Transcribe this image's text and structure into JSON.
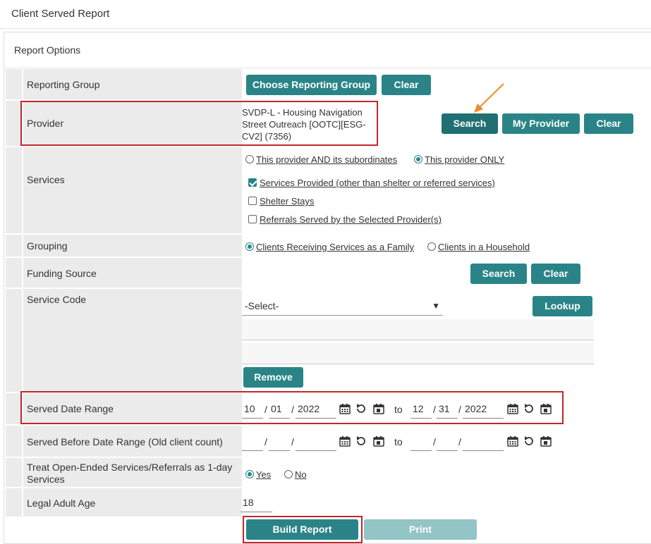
{
  "window_title": "Client Served Report",
  "panel_title": "Report Options",
  "reporting_group": {
    "label": "Reporting Group",
    "choose_button": "Choose Reporting Group",
    "clear_button": "Clear"
  },
  "provider": {
    "label": "Provider",
    "name_line1": "SVDP-L - Housing Navigation",
    "name_line2": "Street Outreach [OOTC][ESG-",
    "name_line3": "CV2] (7356)",
    "search_button": "Search",
    "my_provider_button": "My Provider",
    "clear_button": "Clear",
    "scope_options": [
      {
        "label": "This provider AND its subordinates",
        "selected": false
      },
      {
        "label": "This provider ONLY",
        "selected": true
      }
    ]
  },
  "services": {
    "label": "Services",
    "options": [
      {
        "label": "Services Provided (other than shelter or referred services)",
        "checked": true
      },
      {
        "label": "Shelter Stays",
        "checked": false
      },
      {
        "label": "Referrals Served by the Selected Provider(s)",
        "checked": false
      }
    ]
  },
  "grouping": {
    "label": "Grouping",
    "options": [
      {
        "label": "Clients Receiving Services as a Family",
        "selected": true
      },
      {
        "label": "Clients in a Household",
        "selected": false
      }
    ]
  },
  "funding_source": {
    "label": "Funding Source",
    "search_button": "Search",
    "clear_button": "Clear"
  },
  "service_code": {
    "label": "Service Code",
    "select_value": "-Select-",
    "lookup_button": "Lookup",
    "remove_button": "Remove"
  },
  "served_date_range": {
    "label": "Served Date Range",
    "from": {
      "month": "10",
      "day": "01",
      "year": "2022"
    },
    "to_label": "to",
    "to": {
      "month": "12",
      "day": "31",
      "year": "2022"
    }
  },
  "served_before": {
    "label": "Served Before Date Range (Old client count)",
    "to_label": "to",
    "slash": "/"
  },
  "treat_open_ended": {
    "label_line1": "Treat Open-Ended Services/Referrals as 1-day",
    "label_line2": "Services",
    "options": [
      {
        "label": "Yes",
        "selected": true
      },
      {
        "label": "No",
        "selected": false
      }
    ]
  },
  "legal_adult_age": {
    "label": "Legal Adult Age",
    "value": "18"
  },
  "footer": {
    "build_button": "Build Report",
    "print_button": "Print"
  },
  "colors": {
    "accent": "#2a8487",
    "highlight_box": "#c0282d",
    "arrow": "#f08a24"
  }
}
